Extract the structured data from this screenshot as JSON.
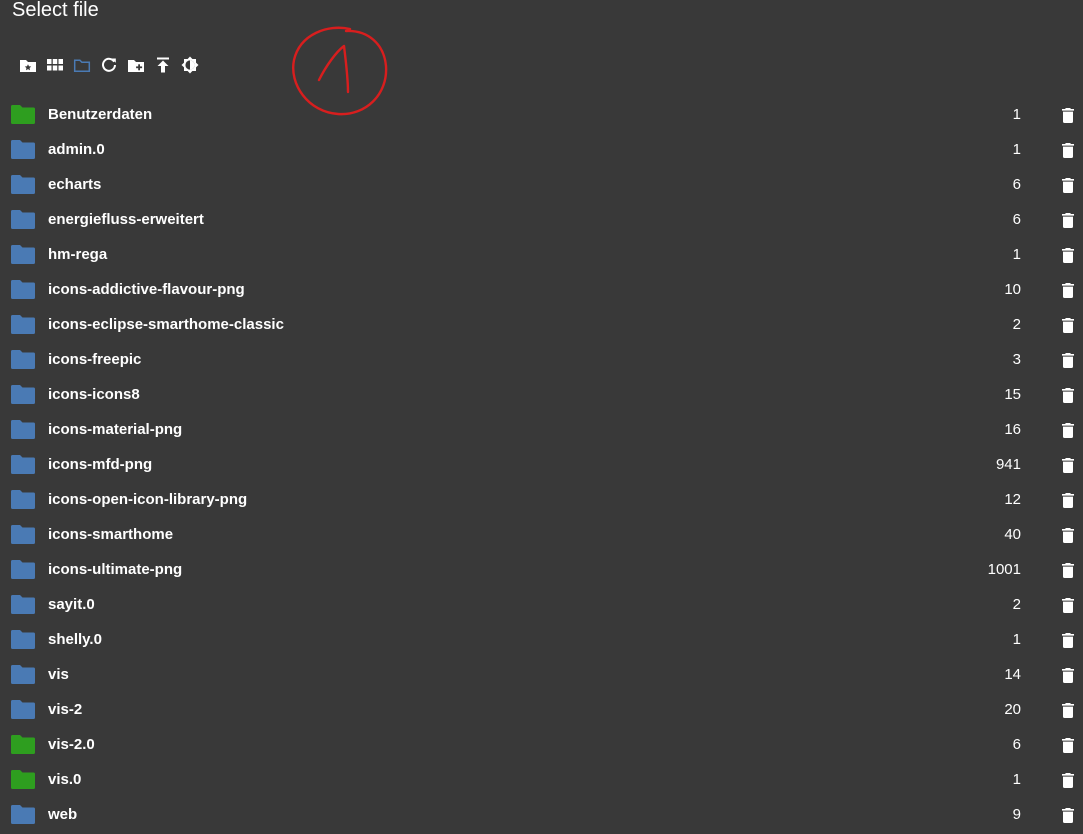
{
  "dialog": {
    "title": "Select file"
  },
  "toolbar": {
    "buttons": [
      {
        "name": "favorites-folder-icon"
      },
      {
        "name": "tile-view-icon"
      },
      {
        "name": "folder-view-icon"
      },
      {
        "name": "refresh-icon"
      },
      {
        "name": "create-folder-icon"
      },
      {
        "name": "upload-icon"
      },
      {
        "name": "brightness-icon"
      }
    ]
  },
  "annotation": {
    "text": "1",
    "color": "#d81e1e"
  },
  "colors": {
    "background": "#393939",
    "folder_blue": "#4a7ab4",
    "folder_green": "#2e9e1f",
    "text": "#ffffff"
  },
  "folders": [
    {
      "name": "Benutzerdaten",
      "count": "1",
      "color": "green"
    },
    {
      "name": "admin.0",
      "count": "1",
      "color": "blue"
    },
    {
      "name": "echarts",
      "count": "6",
      "color": "blue"
    },
    {
      "name": "energiefluss-erweitert",
      "count": "6",
      "color": "blue"
    },
    {
      "name": "hm-rega",
      "count": "1",
      "color": "blue"
    },
    {
      "name": "icons-addictive-flavour-png",
      "count": "10",
      "color": "blue"
    },
    {
      "name": "icons-eclipse-smarthome-classic",
      "count": "2",
      "color": "blue"
    },
    {
      "name": "icons-freepic",
      "count": "3",
      "color": "blue"
    },
    {
      "name": "icons-icons8",
      "count": "15",
      "color": "blue"
    },
    {
      "name": "icons-material-png",
      "count": "16",
      "color": "blue"
    },
    {
      "name": "icons-mfd-png",
      "count": "941",
      "color": "blue"
    },
    {
      "name": "icons-open-icon-library-png",
      "count": "12",
      "color": "blue"
    },
    {
      "name": "icons-smarthome",
      "count": "40",
      "color": "blue"
    },
    {
      "name": "icons-ultimate-png",
      "count": "1001",
      "color": "blue"
    },
    {
      "name": "sayit.0",
      "count": "2",
      "color": "blue"
    },
    {
      "name": "shelly.0",
      "count": "1",
      "color": "blue"
    },
    {
      "name": "vis",
      "count": "14",
      "color": "blue"
    },
    {
      "name": "vis-2",
      "count": "20",
      "color": "blue"
    },
    {
      "name": "vis-2.0",
      "count": "6",
      "color": "green"
    },
    {
      "name": "vis.0",
      "count": "1",
      "color": "green"
    },
    {
      "name": "web",
      "count": "9",
      "color": "blue"
    }
  ]
}
